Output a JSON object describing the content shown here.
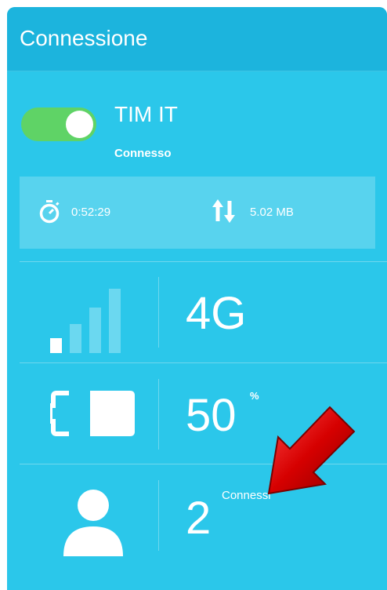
{
  "header": {
    "title": "Connessione"
  },
  "connection": {
    "toggle_on": true,
    "operator": "TIM IT",
    "status": "Connesso",
    "duration": "0:52:29",
    "data_usage": "5.02 MB"
  },
  "network": {
    "type": "4G",
    "signal_bars_active": 1,
    "signal_bars_total": 4
  },
  "battery": {
    "value": "50",
    "unit": "%"
  },
  "clients": {
    "count": "2",
    "label": "Connessi"
  },
  "colors": {
    "panel_bg": "#2bc7ea",
    "header_bg": "#1cb4dd",
    "toggle_on": "#5fd366",
    "annotation_arrow": "#d10000"
  },
  "icons": {
    "timer": "stopwatch-icon",
    "data": "up-down-arrows-icon",
    "signal": "signal-bars-icon",
    "battery": "battery-icon",
    "clients": "user-icon"
  }
}
